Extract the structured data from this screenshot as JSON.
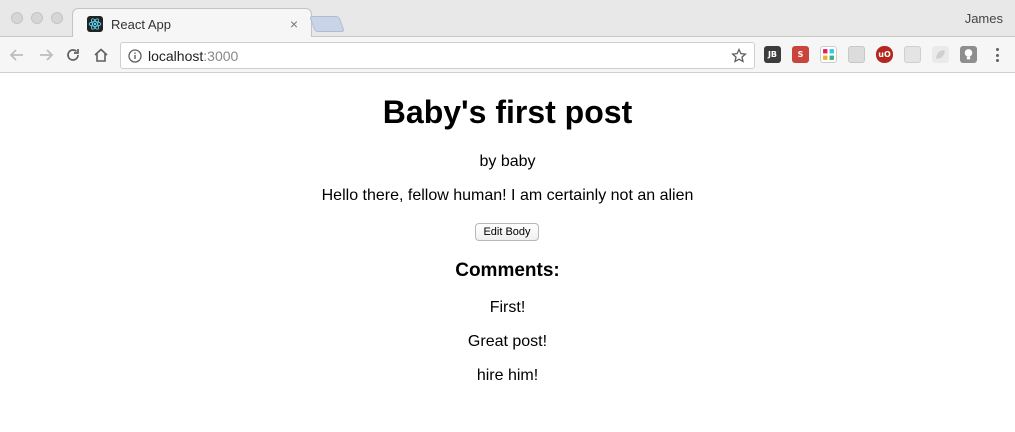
{
  "browser": {
    "tab_title": "React App",
    "tab_close": "×",
    "profile_name": "James",
    "url_host": "localhost",
    "url_port": ":3000",
    "icons": [
      "back-arrow-icon",
      "forward-arrow-icon",
      "reload-icon",
      "home-icon",
      "info-icon",
      "star-icon",
      "menu-icon"
    ],
    "extensions": [
      {
        "name": "jetbrains-extension-icon",
        "label": "JB",
        "color": "#3c3c3c"
      },
      {
        "name": "s-extension-icon",
        "label": "S",
        "color": "#c9443b"
      },
      {
        "name": "slack-extension-icon",
        "label": "",
        "color": "#e9e9e9"
      },
      {
        "name": "grey-extension-icon",
        "label": "",
        "color": "#dcdcdc"
      },
      {
        "name": "ublock-extension-icon",
        "label": "uO",
        "color": "#b5271e"
      },
      {
        "name": "grid-extension-icon",
        "label": "",
        "color": "#dcdcdc"
      },
      {
        "name": "leaf-extension-icon",
        "label": "",
        "color": "#e2e2e2"
      },
      {
        "name": "bulb-extension-icon",
        "label": "",
        "color": "#8e8e8e"
      }
    ]
  },
  "post": {
    "title": "Baby's first post",
    "author_line": "by baby",
    "body": "Hello there, fellow human! I am certainly not an alien",
    "edit_button_label": "Edit Body"
  },
  "comments": {
    "heading": "Comments:",
    "items": [
      "First!",
      "Great post!",
      "hire him!"
    ]
  }
}
